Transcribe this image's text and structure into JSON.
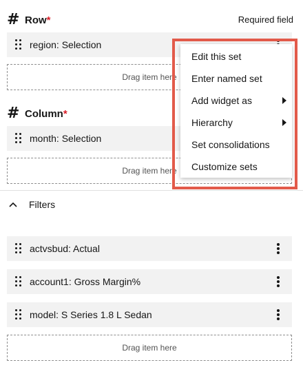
{
  "row": {
    "title": "Row",
    "required_mark": "*",
    "required_note": "Required field",
    "item": "region: Selection",
    "dropzone": "Drag item here"
  },
  "column": {
    "title": "Column",
    "required_mark": "*",
    "item": "month: Selection",
    "dropzone": "Drag item here"
  },
  "filters": {
    "title": "Filters",
    "items": [
      {
        "label": "actvsbud: Actual"
      },
      {
        "label": "account1: Gross Margin%"
      },
      {
        "label": "model: S Series 1.8 L Sedan"
      }
    ],
    "dropzone": "Drag item here"
  },
  "context_menu": {
    "items": [
      {
        "label": "Edit this set"
      },
      {
        "label": "Enter named set"
      },
      {
        "label": "Add widget as"
      },
      {
        "label": "Hierarchy"
      },
      {
        "label": "Set consolidations"
      },
      {
        "label": "Customize sets"
      }
    ]
  },
  "colors": {
    "required": "#da1e28",
    "highlight": "#e25a4a",
    "pill_bg": "#f2f2f2"
  },
  "icons": [
    "hash-icon",
    "drag-handle-icon",
    "overflow-menu-icon",
    "chevron-up-icon",
    "caret-right-icon"
  ]
}
